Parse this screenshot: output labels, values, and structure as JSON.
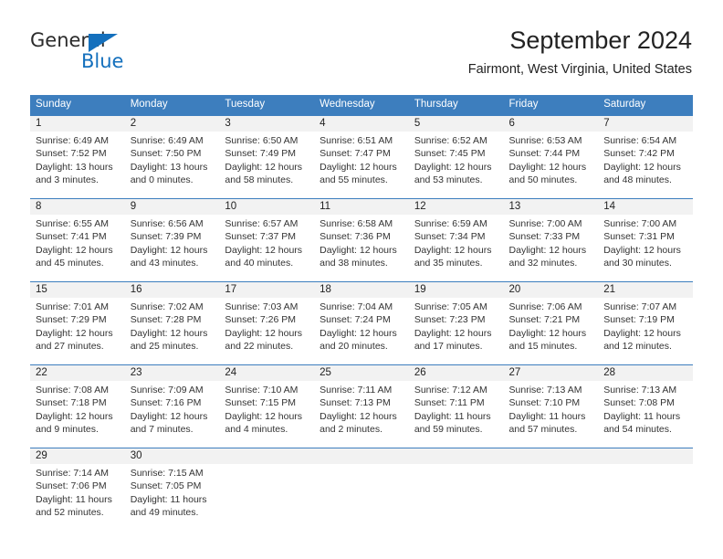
{
  "branding": {
    "name_part1": "General",
    "name_part2": "Blue",
    "triangle_icon": "triangle-icon",
    "accent_color": "#1470bd"
  },
  "header": {
    "title": "September 2024",
    "subtitle": "Fairmont, West Virginia, United States"
  },
  "calendar": {
    "header_color": "#3d7ebe",
    "daynum_band_color": "#f2f2f2",
    "weekdays": [
      "Sunday",
      "Monday",
      "Tuesday",
      "Wednesday",
      "Thursday",
      "Friday",
      "Saturday"
    ],
    "weeks": [
      [
        {
          "day": "1",
          "sunrise": "Sunrise: 6:49 AM",
          "sunset": "Sunset: 7:52 PM",
          "daylight_line1": "Daylight: 13 hours",
          "daylight_line2": "and 3 minutes."
        },
        {
          "day": "2",
          "sunrise": "Sunrise: 6:49 AM",
          "sunset": "Sunset: 7:50 PM",
          "daylight_line1": "Daylight: 13 hours",
          "daylight_line2": "and 0 minutes."
        },
        {
          "day": "3",
          "sunrise": "Sunrise: 6:50 AM",
          "sunset": "Sunset: 7:49 PM",
          "daylight_line1": "Daylight: 12 hours",
          "daylight_line2": "and 58 minutes."
        },
        {
          "day": "4",
          "sunrise": "Sunrise: 6:51 AM",
          "sunset": "Sunset: 7:47 PM",
          "daylight_line1": "Daylight: 12 hours",
          "daylight_line2": "and 55 minutes."
        },
        {
          "day": "5",
          "sunrise": "Sunrise: 6:52 AM",
          "sunset": "Sunset: 7:45 PM",
          "daylight_line1": "Daylight: 12 hours",
          "daylight_line2": "and 53 minutes."
        },
        {
          "day": "6",
          "sunrise": "Sunrise: 6:53 AM",
          "sunset": "Sunset: 7:44 PM",
          "daylight_line1": "Daylight: 12 hours",
          "daylight_line2": "and 50 minutes."
        },
        {
          "day": "7",
          "sunrise": "Sunrise: 6:54 AM",
          "sunset": "Sunset: 7:42 PM",
          "daylight_line1": "Daylight: 12 hours",
          "daylight_line2": "and 48 minutes."
        }
      ],
      [
        {
          "day": "8",
          "sunrise": "Sunrise: 6:55 AM",
          "sunset": "Sunset: 7:41 PM",
          "daylight_line1": "Daylight: 12 hours",
          "daylight_line2": "and 45 minutes."
        },
        {
          "day": "9",
          "sunrise": "Sunrise: 6:56 AM",
          "sunset": "Sunset: 7:39 PM",
          "daylight_line1": "Daylight: 12 hours",
          "daylight_line2": "and 43 minutes."
        },
        {
          "day": "10",
          "sunrise": "Sunrise: 6:57 AM",
          "sunset": "Sunset: 7:37 PM",
          "daylight_line1": "Daylight: 12 hours",
          "daylight_line2": "and 40 minutes."
        },
        {
          "day": "11",
          "sunrise": "Sunrise: 6:58 AM",
          "sunset": "Sunset: 7:36 PM",
          "daylight_line1": "Daylight: 12 hours",
          "daylight_line2": "and 38 minutes."
        },
        {
          "day": "12",
          "sunrise": "Sunrise: 6:59 AM",
          "sunset": "Sunset: 7:34 PM",
          "daylight_line1": "Daylight: 12 hours",
          "daylight_line2": "and 35 minutes."
        },
        {
          "day": "13",
          "sunrise": "Sunrise: 7:00 AM",
          "sunset": "Sunset: 7:33 PM",
          "daylight_line1": "Daylight: 12 hours",
          "daylight_line2": "and 32 minutes."
        },
        {
          "day": "14",
          "sunrise": "Sunrise: 7:00 AM",
          "sunset": "Sunset: 7:31 PM",
          "daylight_line1": "Daylight: 12 hours",
          "daylight_line2": "and 30 minutes."
        }
      ],
      [
        {
          "day": "15",
          "sunrise": "Sunrise: 7:01 AM",
          "sunset": "Sunset: 7:29 PM",
          "daylight_line1": "Daylight: 12 hours",
          "daylight_line2": "and 27 minutes."
        },
        {
          "day": "16",
          "sunrise": "Sunrise: 7:02 AM",
          "sunset": "Sunset: 7:28 PM",
          "daylight_line1": "Daylight: 12 hours",
          "daylight_line2": "and 25 minutes."
        },
        {
          "day": "17",
          "sunrise": "Sunrise: 7:03 AM",
          "sunset": "Sunset: 7:26 PM",
          "daylight_line1": "Daylight: 12 hours",
          "daylight_line2": "and 22 minutes."
        },
        {
          "day": "18",
          "sunrise": "Sunrise: 7:04 AM",
          "sunset": "Sunset: 7:24 PM",
          "daylight_line1": "Daylight: 12 hours",
          "daylight_line2": "and 20 minutes."
        },
        {
          "day": "19",
          "sunrise": "Sunrise: 7:05 AM",
          "sunset": "Sunset: 7:23 PM",
          "daylight_line1": "Daylight: 12 hours",
          "daylight_line2": "and 17 minutes."
        },
        {
          "day": "20",
          "sunrise": "Sunrise: 7:06 AM",
          "sunset": "Sunset: 7:21 PM",
          "daylight_line1": "Daylight: 12 hours",
          "daylight_line2": "and 15 minutes."
        },
        {
          "day": "21",
          "sunrise": "Sunrise: 7:07 AM",
          "sunset": "Sunset: 7:19 PM",
          "daylight_line1": "Daylight: 12 hours",
          "daylight_line2": "and 12 minutes."
        }
      ],
      [
        {
          "day": "22",
          "sunrise": "Sunrise: 7:08 AM",
          "sunset": "Sunset: 7:18 PM",
          "daylight_line1": "Daylight: 12 hours",
          "daylight_line2": "and 9 minutes."
        },
        {
          "day": "23",
          "sunrise": "Sunrise: 7:09 AM",
          "sunset": "Sunset: 7:16 PM",
          "daylight_line1": "Daylight: 12 hours",
          "daylight_line2": "and 7 minutes."
        },
        {
          "day": "24",
          "sunrise": "Sunrise: 7:10 AM",
          "sunset": "Sunset: 7:15 PM",
          "daylight_line1": "Daylight: 12 hours",
          "daylight_line2": "and 4 minutes."
        },
        {
          "day": "25",
          "sunrise": "Sunrise: 7:11 AM",
          "sunset": "Sunset: 7:13 PM",
          "daylight_line1": "Daylight: 12 hours",
          "daylight_line2": "and 2 minutes."
        },
        {
          "day": "26",
          "sunrise": "Sunrise: 7:12 AM",
          "sunset": "Sunset: 7:11 PM",
          "daylight_line1": "Daylight: 11 hours",
          "daylight_line2": "and 59 minutes."
        },
        {
          "day": "27",
          "sunrise": "Sunrise: 7:13 AM",
          "sunset": "Sunset: 7:10 PM",
          "daylight_line1": "Daylight: 11 hours",
          "daylight_line2": "and 57 minutes."
        },
        {
          "day": "28",
          "sunrise": "Sunrise: 7:13 AM",
          "sunset": "Sunset: 7:08 PM",
          "daylight_line1": "Daylight: 11 hours",
          "daylight_line2": "and 54 minutes."
        }
      ],
      [
        {
          "day": "29",
          "sunrise": "Sunrise: 7:14 AM",
          "sunset": "Sunset: 7:06 PM",
          "daylight_line1": "Daylight: 11 hours",
          "daylight_line2": "and 52 minutes."
        },
        {
          "day": "30",
          "sunrise": "Sunrise: 7:15 AM",
          "sunset": "Sunset: 7:05 PM",
          "daylight_line1": "Daylight: 11 hours",
          "daylight_line2": "and 49 minutes."
        },
        {
          "day": "",
          "sunrise": "",
          "sunset": "",
          "daylight_line1": "",
          "daylight_line2": ""
        },
        {
          "day": "",
          "sunrise": "",
          "sunset": "",
          "daylight_line1": "",
          "daylight_line2": ""
        },
        {
          "day": "",
          "sunrise": "",
          "sunset": "",
          "daylight_line1": "",
          "daylight_line2": ""
        },
        {
          "day": "",
          "sunrise": "",
          "sunset": "",
          "daylight_line1": "",
          "daylight_line2": ""
        },
        {
          "day": "",
          "sunrise": "",
          "sunset": "",
          "daylight_line1": "",
          "daylight_line2": ""
        }
      ]
    ]
  }
}
